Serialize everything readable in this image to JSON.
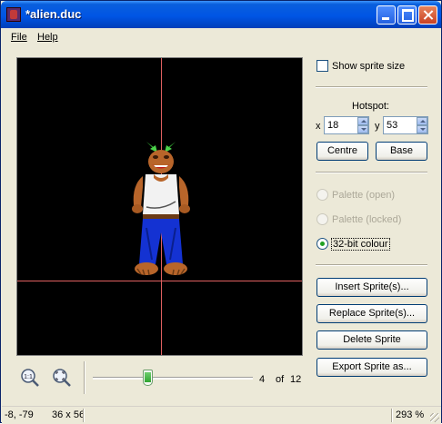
{
  "window": {
    "title": "*alien.duc"
  },
  "menu": {
    "file": "File",
    "help": "Help"
  },
  "options": {
    "show_sprite_size": "Show sprite size",
    "show_sprite_size_checked": false
  },
  "hotspot": {
    "label": "Hotspot:",
    "x_label": "x",
    "x_value": "18",
    "y_label": "y",
    "y_value": "53"
  },
  "buttons": {
    "centre": "Centre",
    "base": "Base",
    "insert": "Insert Sprite(s)...",
    "replace": "Replace Sprite(s)...",
    "delete": "Delete Sprite",
    "export": "Export Sprite as..."
  },
  "palette_modes": [
    {
      "label": "Palette (open)",
      "enabled": false,
      "selected": false
    },
    {
      "label": "Palette (locked)",
      "enabled": false,
      "selected": false
    },
    {
      "label": "32-bit colour",
      "enabled": true,
      "selected": true
    }
  ],
  "navigator": {
    "current": "4",
    "of_label": "of",
    "total": "12",
    "slider_fraction": 0.27
  },
  "status": {
    "coords": "-8, -79",
    "size": "36 x 56",
    "zoom": "293 %"
  },
  "colors": {
    "crosshair": "#e06060",
    "canvas_bg": "#000000",
    "title_bar": "#0055e5"
  },
  "icons": [
    "zoom-actual-size-icon",
    "zoom-fit-icon"
  ]
}
